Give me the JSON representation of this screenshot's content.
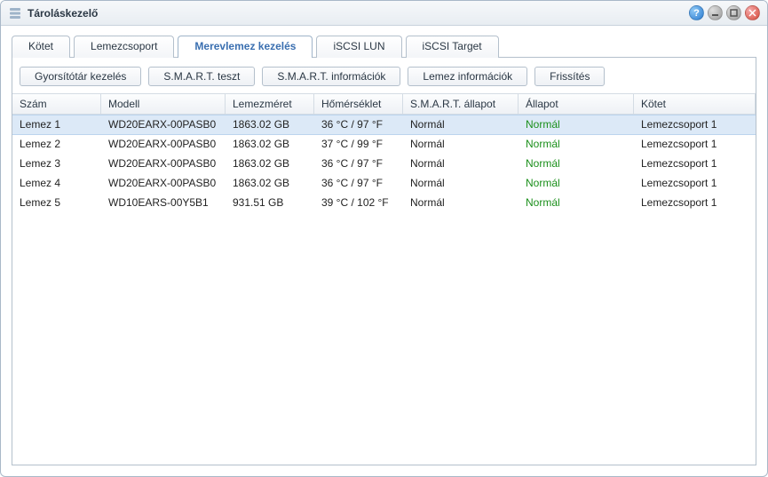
{
  "window": {
    "title": "Tároláskezelő"
  },
  "tabs": [
    {
      "label": "Kötet",
      "active": false
    },
    {
      "label": "Lemezcsoport",
      "active": false
    },
    {
      "label": "Merevlemez kezelés",
      "active": true
    },
    {
      "label": "iSCSI LUN",
      "active": false
    },
    {
      "label": "iSCSI Target",
      "active": false
    }
  ],
  "toolbar": {
    "cache": "Gyorsítótár kezelés",
    "smart_test": "S.M.A.R.T. teszt",
    "smart_info": "S.M.A.R.T. információk",
    "disk_info": "Lemez információk",
    "refresh": "Frissítés"
  },
  "columns": {
    "num": "Szám",
    "model": "Modell",
    "size": "Lemezméret",
    "temp": "Hőmérséklet",
    "smart": "S.M.A.R.T. állapot",
    "status": "Állapot",
    "volume": "Kötet"
  },
  "rows": [
    {
      "num": "Lemez 1",
      "model": "WD20EARX-00PASB0",
      "size": "1863.02 GB",
      "temp": "36 °C / 97 °F",
      "smart": "Normál",
      "status": "Normál",
      "volume": "Lemezcsoport 1",
      "selected": true
    },
    {
      "num": "Lemez 2",
      "model": "WD20EARX-00PASB0",
      "size": "1863.02 GB",
      "temp": "37 °C / 99 °F",
      "smart": "Normál",
      "status": "Normál",
      "volume": "Lemezcsoport 1",
      "selected": false
    },
    {
      "num": "Lemez 3",
      "model": "WD20EARX-00PASB0",
      "size": "1863.02 GB",
      "temp": "36 °C / 97 °F",
      "smart": "Normál",
      "status": "Normál",
      "volume": "Lemezcsoport 1",
      "selected": false
    },
    {
      "num": "Lemez 4",
      "model": "WD20EARX-00PASB0",
      "size": "1863.02 GB",
      "temp": "36 °C / 97 °F",
      "smart": "Normál",
      "status": "Normál",
      "volume": "Lemezcsoport 1",
      "selected": false
    },
    {
      "num": "Lemez 5",
      "model": "WD10EARS-00Y5B1",
      "size": "931.51 GB",
      "temp": "39 °C / 102 °F",
      "smart": "Normál",
      "status": "Normál",
      "volume": "Lemezcsoport 1",
      "selected": false
    }
  ]
}
